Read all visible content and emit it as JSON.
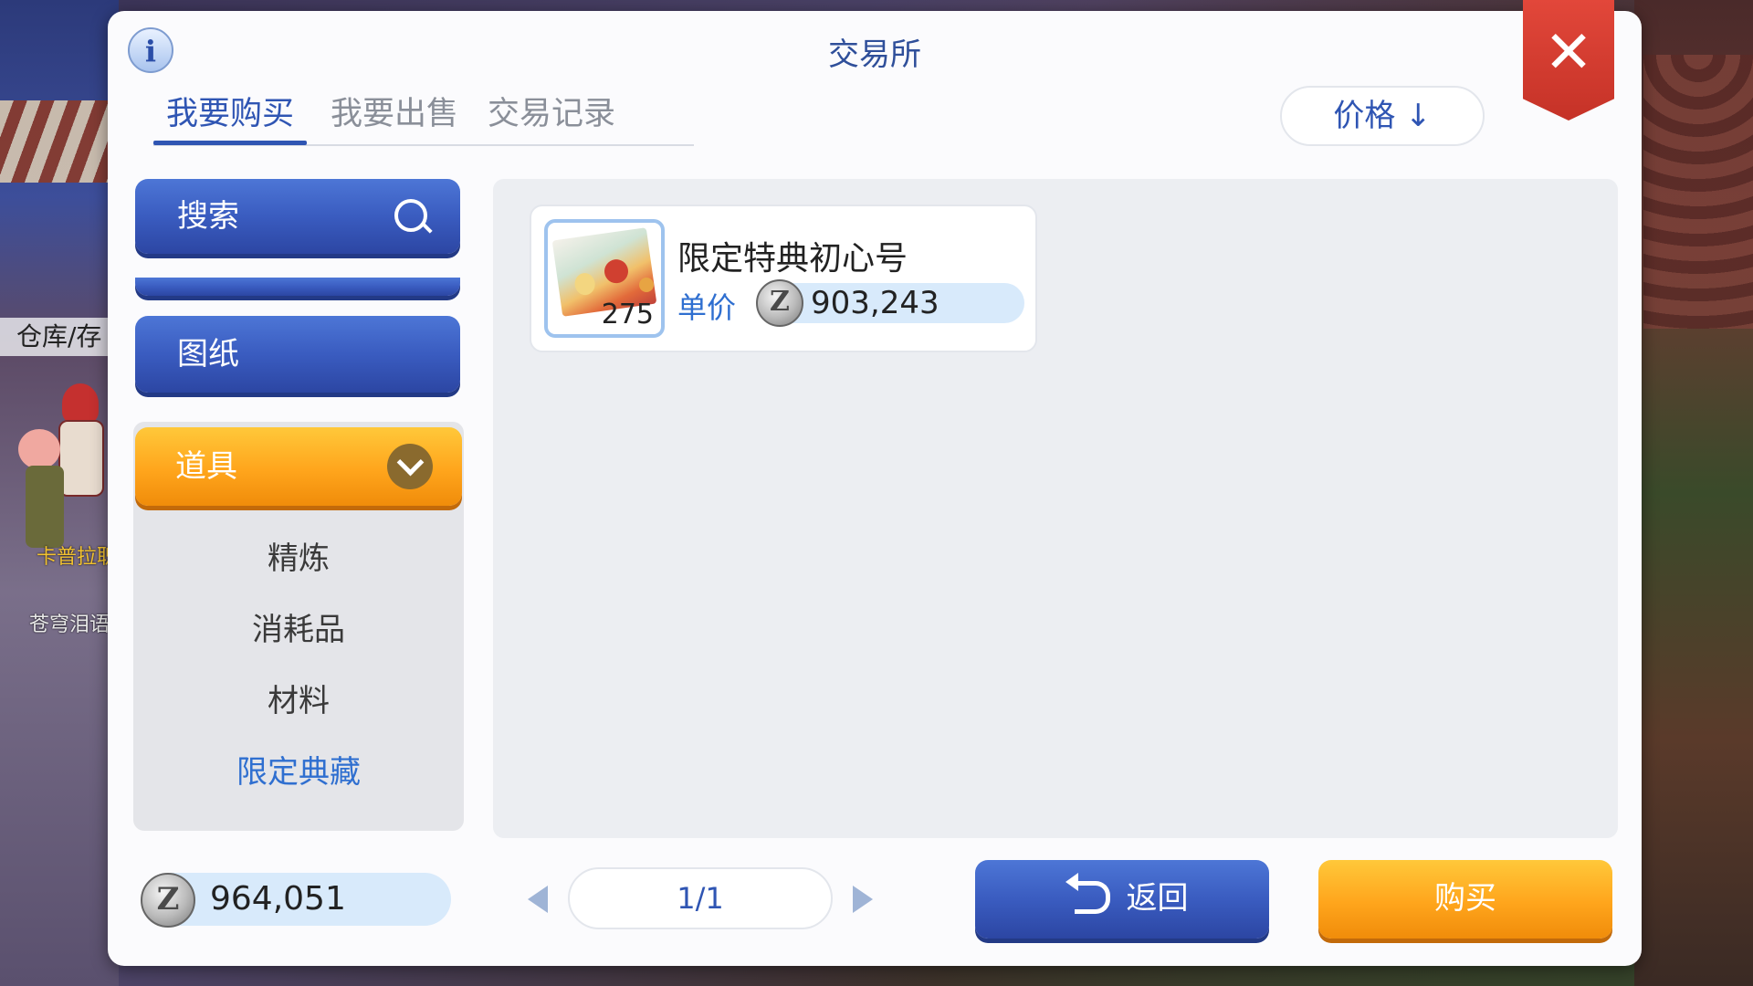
{
  "background": {
    "side_label": "仓库/存",
    "npc_name_1": "卡普拉职",
    "npc_name_2": "苍穹泪语"
  },
  "dialog": {
    "title": "交易所",
    "info_icon": "i",
    "close_icon": "✕"
  },
  "tabs": [
    {
      "label": "我要购买",
      "active": true
    },
    {
      "label": "我要出售",
      "active": false
    },
    {
      "label": "交易记录",
      "active": false
    }
  ],
  "sort": {
    "label": "价格 ↓"
  },
  "sidebar": {
    "search_label": "搜索",
    "blueprint_label": "图纸",
    "category": {
      "label": "道具",
      "expanded": true,
      "items": [
        {
          "label": "精炼",
          "active": false
        },
        {
          "label": "消耗品",
          "active": false
        },
        {
          "label": "材料",
          "active": false
        },
        {
          "label": "限定典藏",
          "active": true
        }
      ]
    }
  },
  "listing": {
    "items": [
      {
        "name": "限定特典初心号",
        "count": "275",
        "price_label": "单价",
        "price": "903,243"
      }
    ]
  },
  "footer": {
    "zeny_icon": "Z",
    "balance": "964,051",
    "page": "1/1",
    "back_label": "返回",
    "buy_label": "购买"
  },
  "colors": {
    "accent_blue": "#2f55b3",
    "button_blue": "#3a5cc0",
    "button_orange": "#ffa51c",
    "close_red": "#d43a2e",
    "price_bar": "#d8eafb"
  }
}
